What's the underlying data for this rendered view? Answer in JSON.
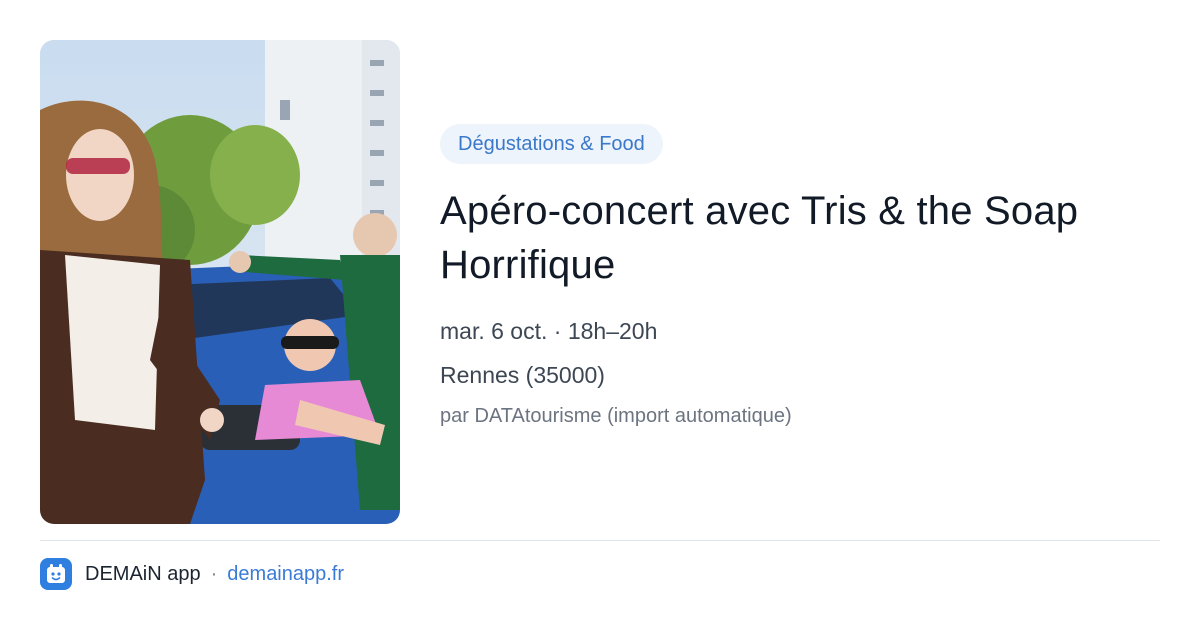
{
  "event": {
    "category": "Dégustations & Food",
    "title": "Apéro-concert avec Tris & the Soap Horrifique",
    "datetime": "mar. 6 oct. · 18h–20h",
    "location": "Rennes (35000)",
    "source": "par DATAtourisme (import automatique)",
    "image_icon": "event-photo"
  },
  "footer": {
    "app_name": "DEMAiN app",
    "separator": "·",
    "link": "demainapp.fr",
    "app_icon": "demain-app-icon"
  },
  "colors": {
    "accent": "#3a78c9",
    "category_bg": "#eef4fb",
    "app_icon_bg": "#2f7fe0",
    "divider": "#dfe5ea"
  }
}
